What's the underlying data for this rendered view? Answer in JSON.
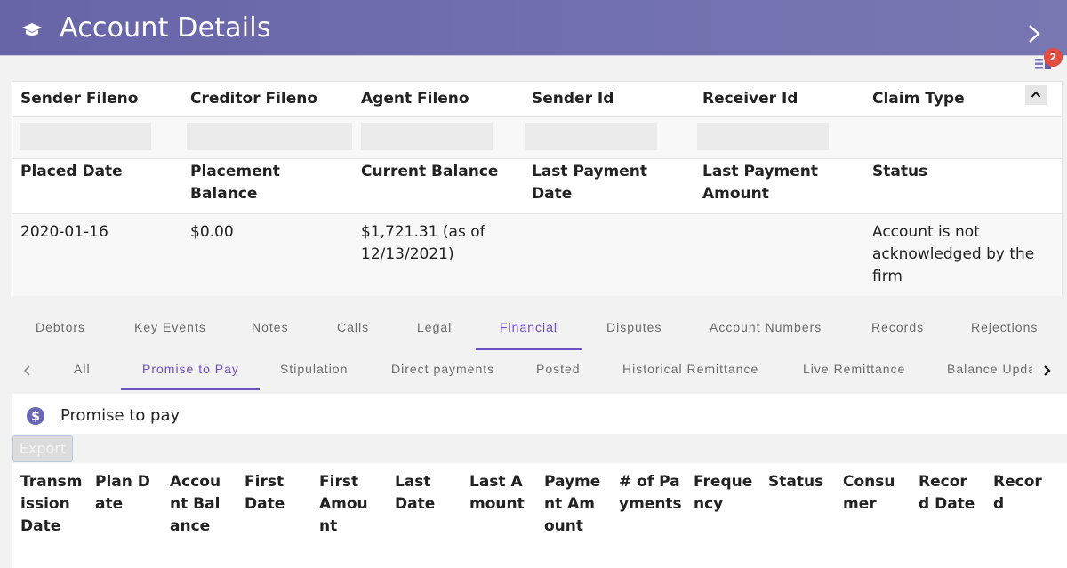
{
  "header": {
    "title": "Account Details",
    "icon": "graduation-cap-icon",
    "next_icon": "chevron-right-icon",
    "accent_color": "#6764a8"
  },
  "notifications": {
    "icon": "list-icon",
    "count": "2",
    "badge_color": "#e24d3f"
  },
  "summary": {
    "row1_headers": [
      "Sender Fileno",
      "Creditor Fileno",
      "Agent Fileno",
      "Sender Id",
      "Receiver Id",
      "Claim Type"
    ],
    "row1_values": [
      "",
      "",
      "",
      "",
      "",
      ""
    ],
    "row2_headers": [
      "Placed Date",
      "Placement Balance",
      "Current Balance",
      "Last Payment Date",
      "Last Payment Amount",
      "Status"
    ],
    "row2_values": [
      "2020-01-16",
      "$0.00",
      "$1,721.31 (as of 12/13/2021)",
      "",
      "",
      "Account is not acknowledged by the firm"
    ],
    "collapse_icon": "chevron-up-icon"
  },
  "tabs": {
    "items": [
      "Debtors",
      "Key Events",
      "Notes",
      "Calls",
      "Legal",
      "Financial",
      "Disputes",
      "Account Numbers",
      "Records",
      "Rejections"
    ],
    "active": "Financial"
  },
  "subtabs": {
    "items": [
      "All",
      "Promise to Pay",
      "Stipulation",
      "Direct payments",
      "Posted",
      "Historical Remittance",
      "Live Remittance",
      "Balance Upda"
    ],
    "active": "Promise to Pay"
  },
  "panel": {
    "icon": "dollar-circle-icon",
    "title": "Promise to pay",
    "export_label": "Export"
  },
  "table": {
    "columns": [
      "Transmission Date",
      "Plan Date",
      "Account Balance",
      "First Date",
      "First Amount",
      "Last Date",
      "Last Amount",
      "Payment Amount",
      "# of Payments",
      "Frequency",
      "Status",
      "Consumer",
      "Record Date",
      "Record"
    ],
    "rows": []
  }
}
